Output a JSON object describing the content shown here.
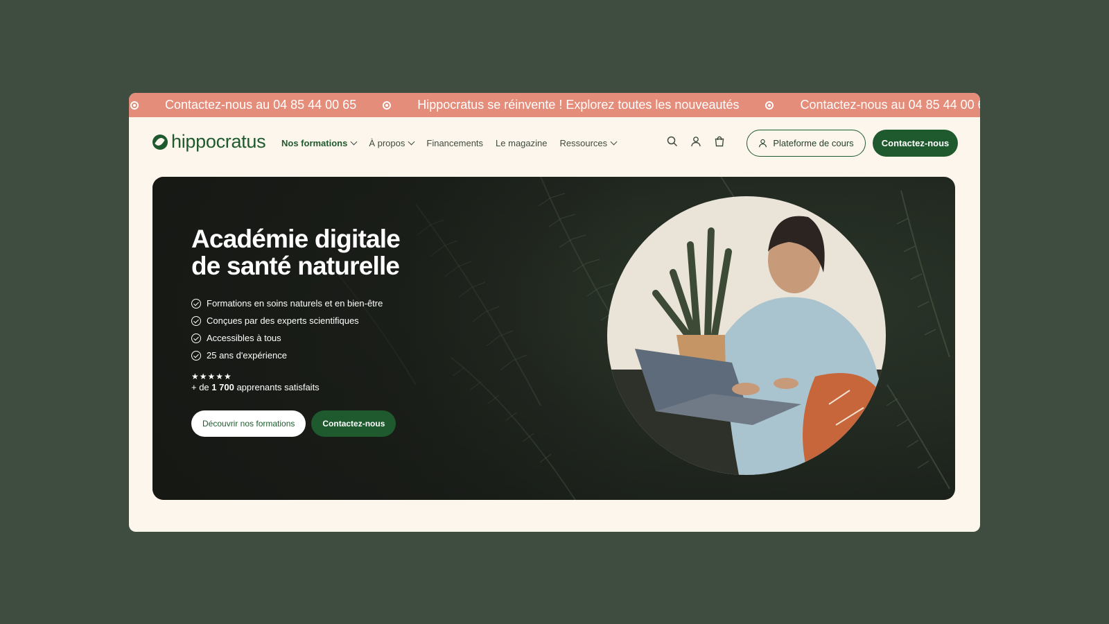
{
  "announcement": {
    "messages": [
      "Contactez-nous au 04 85 44 00 65",
      "Hippocratus se réinvente ! Explorez toutes les nouveautés",
      "Contactez-nous au 04 85 44 00 65"
    ]
  },
  "brand": {
    "name": "hippocratus"
  },
  "nav": {
    "items": [
      {
        "label": "Nos formations",
        "dropdown": true,
        "active": true
      },
      {
        "label": "À propos",
        "dropdown": true
      },
      {
        "label": "Financements"
      },
      {
        "label": "Le magazine"
      },
      {
        "label": "Ressources",
        "dropdown": true
      }
    ],
    "icons": [
      "search-icon",
      "user-icon",
      "cart-icon"
    ],
    "platform_button": "Plateforme de cours",
    "contact_button": "Contactez-nous"
  },
  "hero": {
    "title": "Académie digitale\nde santé naturelle",
    "features": [
      "Formations en soins naturels et en bien-être",
      "Conçues par des experts scientifiques",
      "Accessibles à tous",
      "25 ans d'expérience"
    ],
    "rating": {
      "stars": "★★★★★",
      "prefix": "+ de ",
      "count": "1 700",
      "suffix": " apprenants satisfaits"
    },
    "primary_cta": "Découvrir nos formations",
    "secondary_cta": "Contactez-nous"
  },
  "colors": {
    "page_bg": "#3e4d40",
    "window_bg": "#fdf6ec",
    "announce_bg": "#e58d7b",
    "brand_green": "#1f5a2e"
  }
}
